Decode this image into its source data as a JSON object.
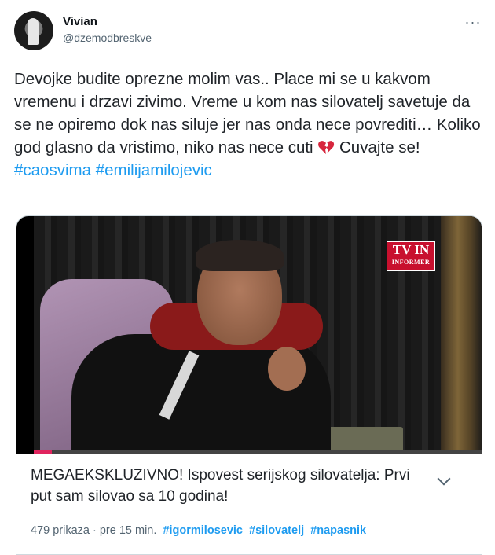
{
  "author": {
    "display_name": "Vivian",
    "handle": "@dzemodbreskve"
  },
  "more_icon": "more-dots-icon",
  "tweet": {
    "text_part1": "Devojke budite oprezne molim vas.. Place mi se u kakvom vremenu i drzavi zivimo. Vreme u kom nas silovatelj savetuje da se ne opiremo dok nas siluje jer nas onda nece povrediti… Koliko god glasno da vristimo, niko nas nece cuti ",
    "emoji": "broken-heart-icon",
    "text_part2": " Cuvajte se! ",
    "hashtags": [
      "#caosvima",
      "#emilijamilojevic"
    ]
  },
  "video": {
    "logo_top": "TV IN",
    "logo_bottom": "INFORMER",
    "progress_fraction": 0.04,
    "progress_color": "#e0245e"
  },
  "card": {
    "title": "MEGAEKSKLUZIVNO! Ispovest serijskog silovatelja: Prvi put sam silovao sa 10 godina!",
    "views": "479 prikaza",
    "time": "· pre 15 min.",
    "tags": [
      "#igormilosevic",
      "#silovatelj",
      "#napasnik"
    ]
  },
  "colors": {
    "link": "#1d9bf0",
    "muted": "#536471",
    "logo_red": "#c8102e"
  }
}
